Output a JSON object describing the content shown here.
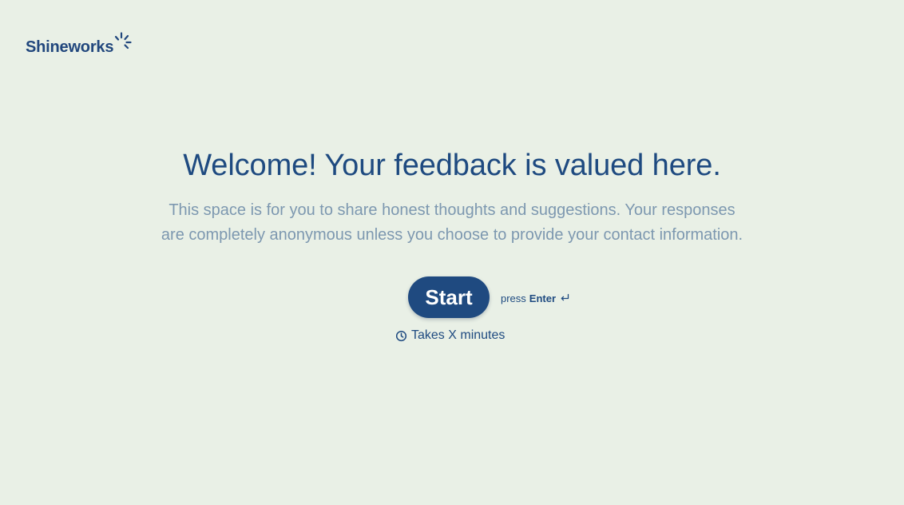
{
  "logo": {
    "text": "Shineworks",
    "icon": "sparkle-icon",
    "color": "#21477d"
  },
  "welcome": {
    "title": "Welcome! Your feedback is valued here.",
    "description_line1": "This space is for you to share honest thoughts and suggestions. Your responses",
    "description_line2": "are completely anonymous unless you choose to provide your contact information."
  },
  "actions": {
    "start_label": "Start",
    "press_prefix": "press",
    "press_key": "Enter",
    "enter_icon": "return-arrow-icon"
  },
  "duration": {
    "icon": "clock-icon",
    "text": "Takes X minutes"
  },
  "colors": {
    "background": "#e9f0e6",
    "primary": "#1f4a80",
    "muted_text": "#7d98b0"
  }
}
